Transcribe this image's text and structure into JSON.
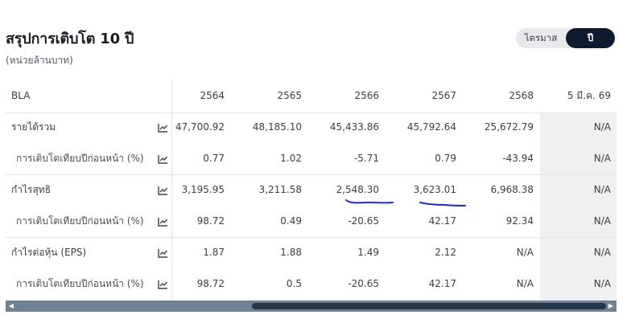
{
  "header": {
    "title": "สรุปการเติบโต 10 ปี",
    "subtitle": "(หน่วยล้านบาท)"
  },
  "toggle": {
    "quarterly_label": "ไตรมาส",
    "yearly_label": "ปี",
    "selected": "ปี"
  },
  "table": {
    "header": {
      "symbol": "BLA",
      "columns": [
        "2564",
        "2565",
        "2566",
        "2567",
        "2568",
        "5 มี.ค. 69"
      ]
    },
    "rows": [
      {
        "label": "รายได้รวม",
        "values": [
          "47,700.92",
          "48,185.10",
          "45,433.86",
          "45,792.64",
          "25,672.79",
          "N/A"
        ]
      },
      {
        "label": "การเติบโตเทียบปีก่อนหน้า (%)",
        "values": [
          "0.77",
          "1.02",
          "-5.71",
          "0.79",
          "-43.94",
          "N/A"
        ]
      },
      {
        "label": "กำไรสุทธิ",
        "values": [
          "3,195.95",
          "3,211.58",
          "2,548.30",
          "3,623.01",
          "6,968.38",
          "N/A"
        ]
      },
      {
        "label": "การเติบโตเทียบปีก่อนหน้า (%)",
        "values": [
          "98.72",
          "0.49",
          "-20.65",
          "42.17",
          "92.34",
          "N/A"
        ]
      },
      {
        "label": "กำไรต่อหุ้น (EPS)",
        "values": [
          "1.87",
          "1.88",
          "1.49",
          "2.12",
          "N/A",
          "N/A"
        ]
      },
      {
        "label": "การเติบโตเทียบปีก่อนหน้า (%)",
        "values": [
          "98.72",
          "0.5",
          "-20.65",
          "42.17",
          "N/A",
          "N/A"
        ]
      }
    ]
  },
  "icons": {
    "row_chart": "line-chart-icon",
    "scroll_left": "arrow-left-icon",
    "scroll_right": "arrow-right-icon"
  },
  "colors": {
    "toggle_active": "#0d1b2e",
    "toggle_bg": "#e7e9ec",
    "scrollbar_track": "#6f8294",
    "scrollbar_thumb": "#263646",
    "pen_annotation": "#1c2fc0",
    "shaded_column": "#eef0f2"
  }
}
